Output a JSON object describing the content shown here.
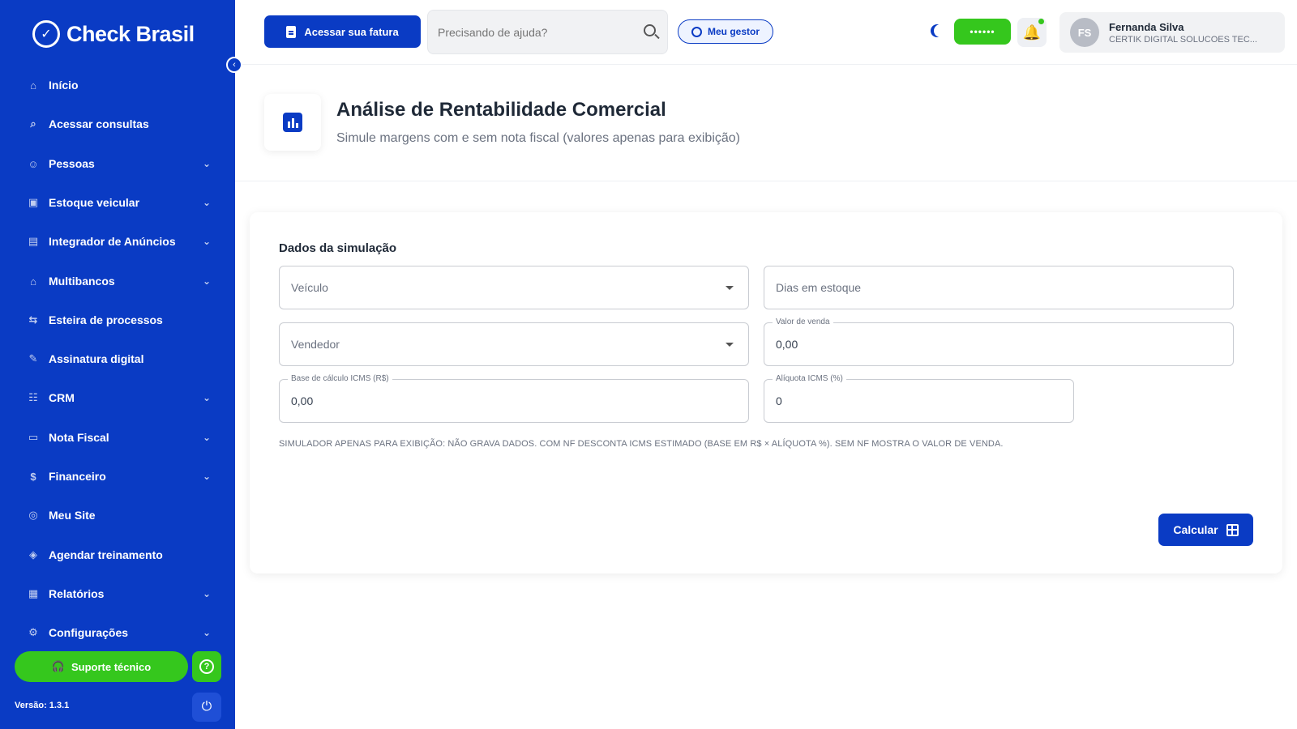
{
  "brand": {
    "name": "Check Brasil",
    "mark": "✓"
  },
  "sidebar": {
    "items": [
      {
        "label": "Início",
        "icon": "home-icon",
        "has_children": false
      },
      {
        "label": "Acessar consultas",
        "icon": "search-icon",
        "has_children": false
      },
      {
        "label": "Pessoas",
        "icon": "people-icon",
        "has_children": true
      },
      {
        "label": "Estoque veicular",
        "icon": "car-icon",
        "has_children": true
      },
      {
        "label": "Integrador de Anúncios",
        "icon": "ads-icon",
        "has_children": true
      },
      {
        "label": "Multibancos",
        "icon": "bank-icon",
        "has_children": true
      },
      {
        "label": "Esteira de processos",
        "icon": "workflow-icon",
        "has_children": false
      },
      {
        "label": "Assinatura digital",
        "icon": "signature-icon",
        "has_children": false
      },
      {
        "label": "CRM",
        "icon": "crm-icon",
        "has_children": true
      },
      {
        "label": "Nota Fiscal",
        "icon": "invoice-icon",
        "has_children": true
      },
      {
        "label": "Financeiro",
        "icon": "money-icon",
        "has_children": true
      },
      {
        "label": "Meu Site",
        "icon": "globe-icon",
        "has_children": false
      },
      {
        "label": "Agendar treinamento",
        "icon": "graduation-icon",
        "has_children": false
      },
      {
        "label": "Relatórios",
        "icon": "report-icon",
        "has_children": true
      },
      {
        "label": "Configurações",
        "icon": "gear-icon",
        "has_children": true
      }
    ],
    "support_label": "Suporte técnico",
    "version": "Versão: 1.3.1"
  },
  "header": {
    "invoice_button": "Acessar sua fatura",
    "search_placeholder": "Precisando de ajuda?",
    "manager_button": "Meu gestor",
    "status_pill": "••••••",
    "user": {
      "initials": "FS",
      "name": "Fernanda Silva",
      "company": "CERTIK DIGITAL SOLUCOES TEC..."
    }
  },
  "page": {
    "title": "Análise de Rentabilidade Comercial",
    "subtitle": "Simule margens com e sem nota fiscal (valores apenas para exibição)"
  },
  "form": {
    "section_title": "Dados da simulação",
    "vehicle_placeholder": "Veículo",
    "days_placeholder": "Dias em estoque",
    "seller_placeholder": "Vendedor",
    "sale_value_label": "Valor de venda",
    "sale_value": "0,00",
    "icms_base_label": "Base de cálculo ICMS (R$)",
    "icms_base": "0,00",
    "icms_rate_label": "Alíquota ICMS (%)",
    "icms_rate": "0",
    "disclaimer": "SIMULADOR APENAS PARA EXIBIÇÃO: NÃO GRAVA DADOS. COM NF DESCONTA ICMS ESTIMADO (BASE EM R$ × ALÍQUOTA %). SEM NF MOSTRA O VALOR DE VENDA.",
    "calculate_button": "Calcular"
  },
  "colors": {
    "primary": "#0a3bc4",
    "success": "#35c71d"
  }
}
